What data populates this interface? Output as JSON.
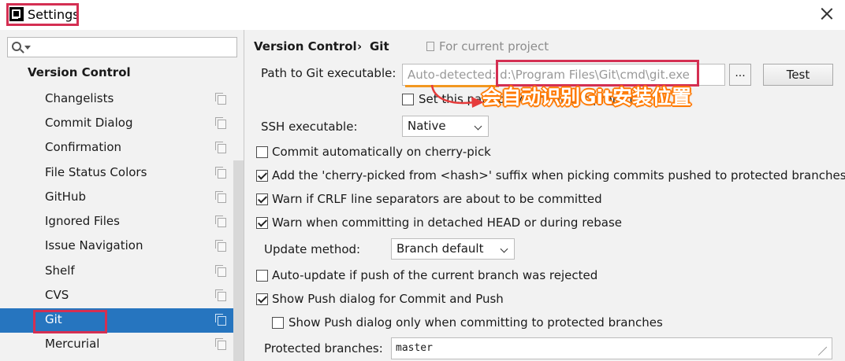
{
  "window": {
    "title": "Settings"
  },
  "search": {
    "placeholder": ""
  },
  "sidebar": {
    "section": "Version Control",
    "items": [
      {
        "label": "Changelists"
      },
      {
        "label": "Commit Dialog"
      },
      {
        "label": "Confirmation"
      },
      {
        "label": "File Status Colors"
      },
      {
        "label": "GitHub"
      },
      {
        "label": "Ignored Files"
      },
      {
        "label": "Issue Navigation"
      },
      {
        "label": "Shelf"
      },
      {
        "label": "CVS"
      },
      {
        "label": "Git",
        "selected": true
      },
      {
        "label": "Mercurial"
      }
    ]
  },
  "breadcrumb": {
    "parent": "Version Control",
    "separator": "›",
    "current": "Git",
    "scope": "For current project"
  },
  "path": {
    "label": "Path to Git executable:",
    "placeholder": "Auto-detected: d:\\Program Files\\Git\\cmd\\git.exe",
    "browse": "...",
    "test": "Test",
    "set_project": "Set this path only for current project"
  },
  "annotation": "会自动识别Git安装位置",
  "ssh": {
    "label": "SSH executable:",
    "value": "Native"
  },
  "options": [
    {
      "label": "Commit automatically on cherry-pick",
      "checked": false
    },
    {
      "label": "Add the 'cherry-picked from <hash>' suffix when picking commits pushed to protected branches",
      "checked": true
    },
    {
      "label": "Warn if CRLF line separators are about to be committed",
      "checked": true
    },
    {
      "label": "Warn when committing in detached HEAD or during rebase",
      "checked": true
    }
  ],
  "update": {
    "label": "Update method:",
    "value": "Branch default"
  },
  "options2": [
    {
      "label": "Auto-update if push of the current branch was rejected",
      "checked": false
    },
    {
      "label": "Show Push dialog for Commit and Push",
      "checked": true
    },
    {
      "label": "Show Push dialog only when committing to protected branches",
      "checked": false
    }
  ],
  "protected": {
    "label": "Protected branches:",
    "value": "master"
  },
  "colors": {
    "selection": "#2675bf",
    "highlight_box": "#d42f52",
    "annotation_outline": "#ff7a00"
  }
}
